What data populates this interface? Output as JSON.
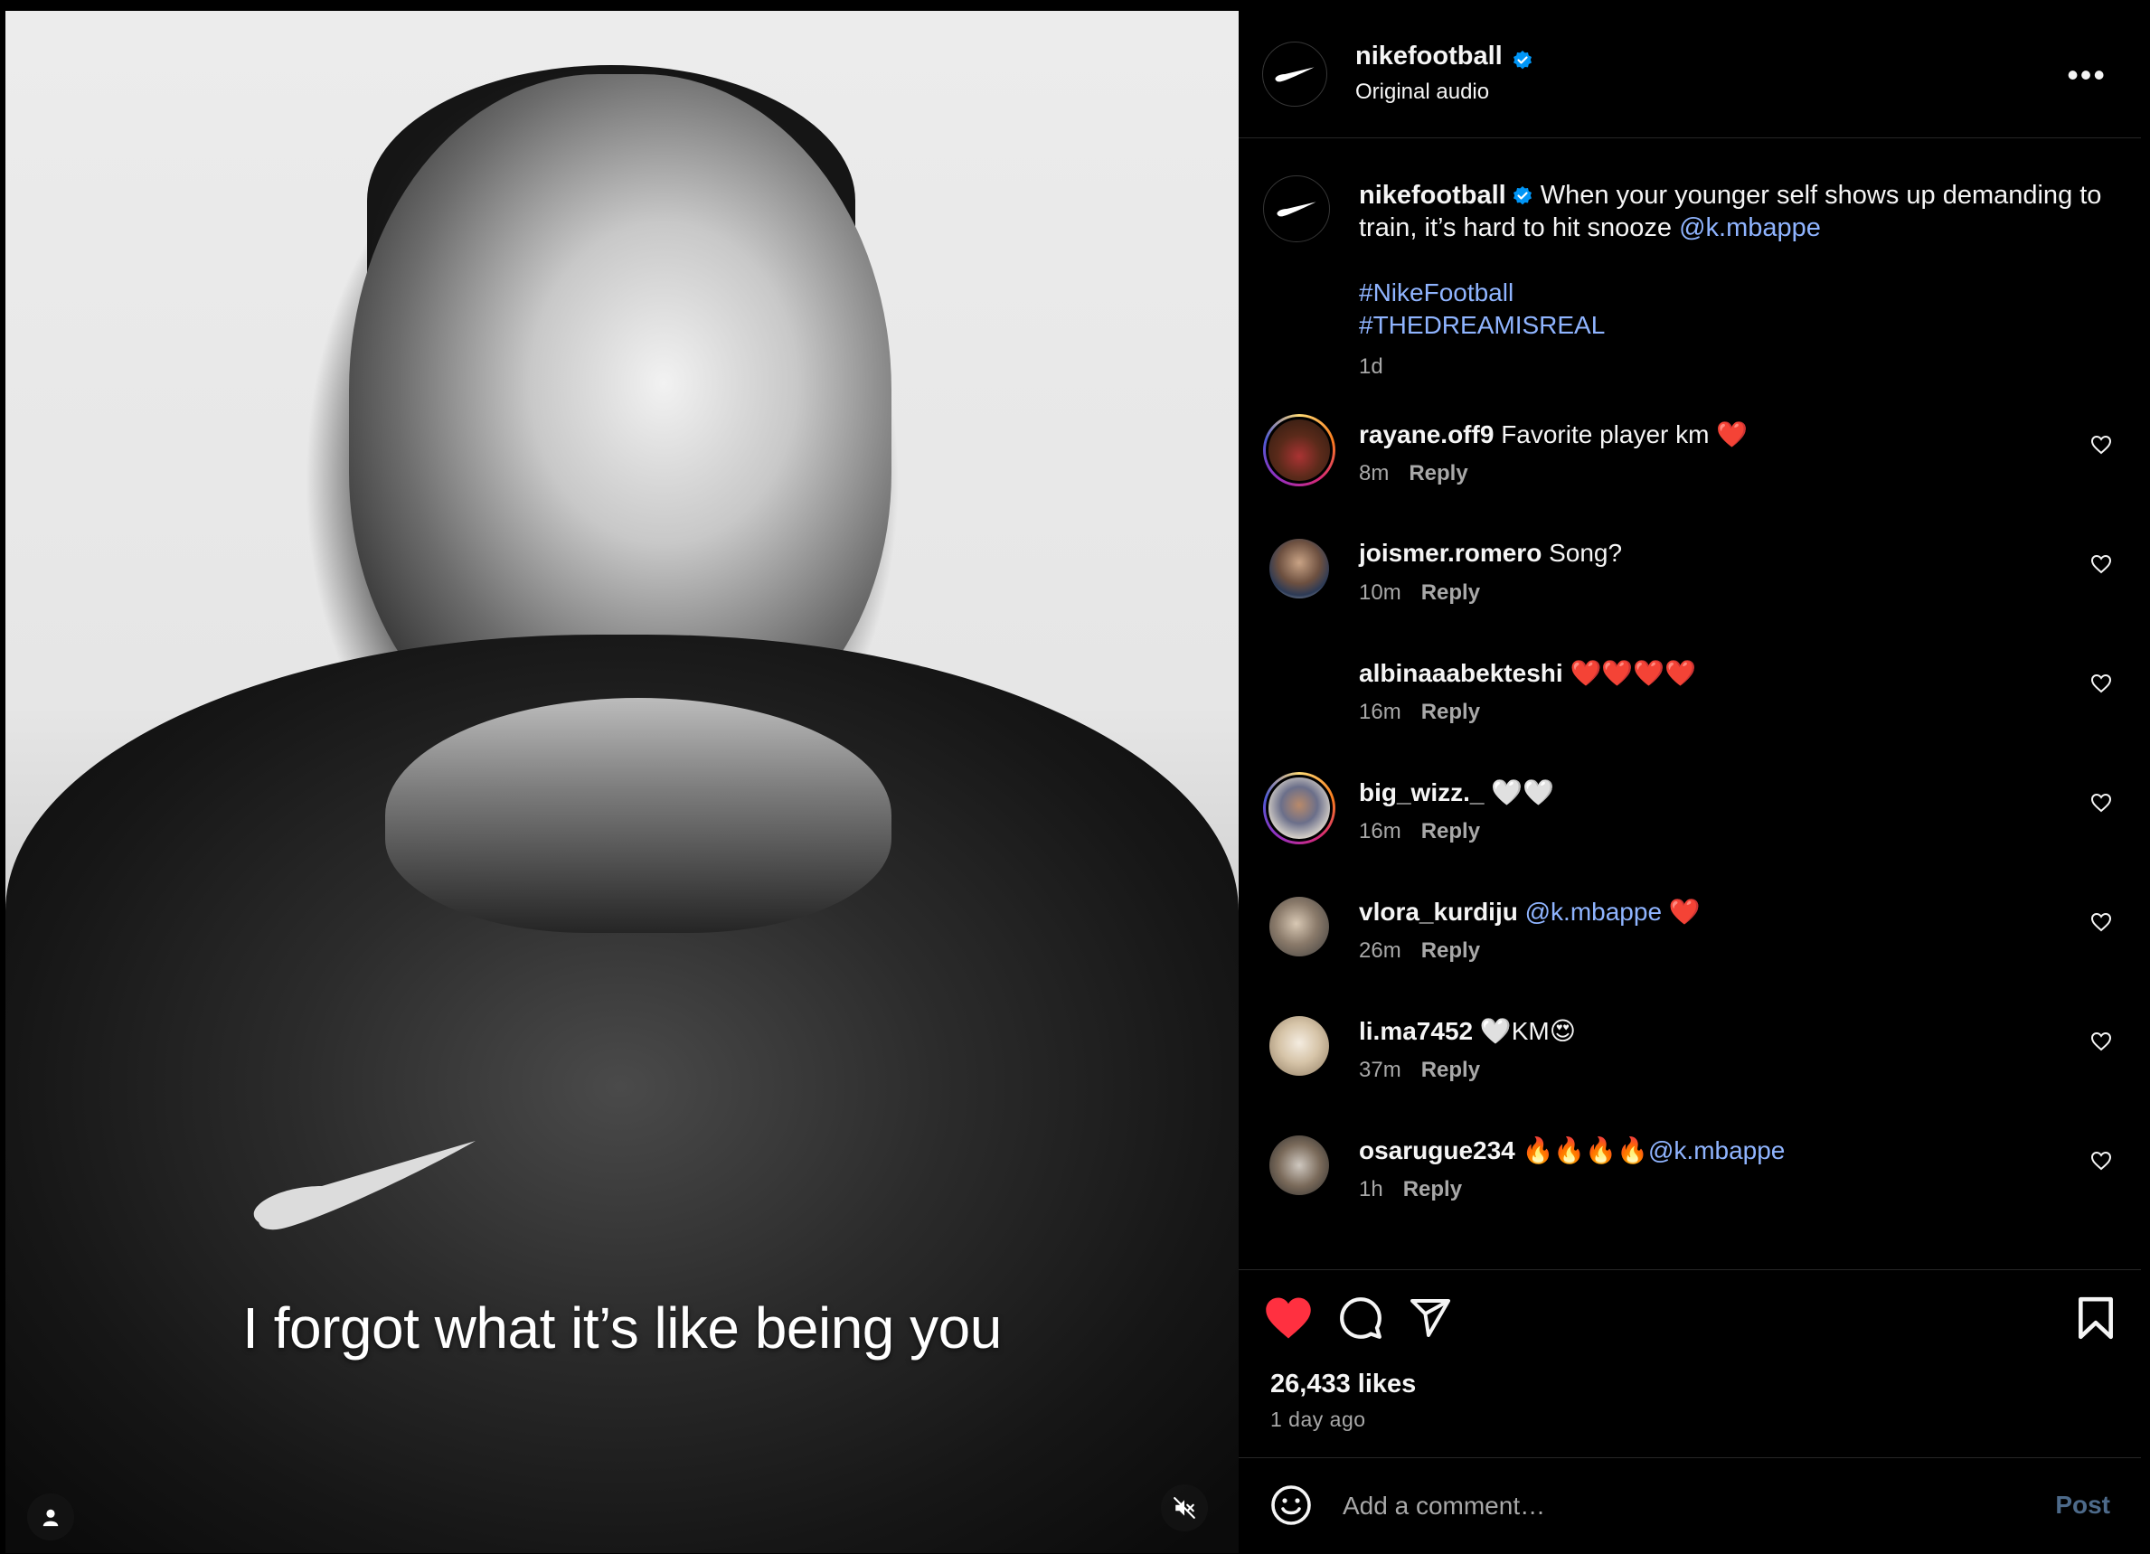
{
  "video": {
    "subtitle": "I forgot what it’s like being you",
    "profile_icon": "person-icon",
    "mute_icon": "volume-muted-icon"
  },
  "header": {
    "username": "nikefootball",
    "audio": "Original audio",
    "more_icon": "more-horizontal-icon",
    "more_label": "•••"
  },
  "post": {
    "username": "nikefootball",
    "text": "When your younger self shows up demanding to train, it’s hard to hit snooze",
    "mention": "@k.mbappe",
    "hashtags": [
      "#NikeFootball",
      "#THEDREAMISREAL"
    ],
    "time": "1d"
  },
  "comments": [
    {
      "user": "rayane.off9",
      "text": "Favorite player km ❤️",
      "time": "8m",
      "reply": "Reply"
    },
    {
      "user": "joismer.romero",
      "text": "Song?",
      "time": "10m",
      "reply": "Reply"
    },
    {
      "user": "albinaaabekteshi",
      "text": "❤️❤️❤️❤️",
      "time": "16m",
      "reply": "Reply"
    },
    {
      "user": "big_wizz._",
      "text": "🤍🤍",
      "time": "16m",
      "reply": "Reply"
    },
    {
      "user": "vlora_kurdiju",
      "text": "❤️",
      "mention": "@k.mbappe",
      "time": "26m",
      "reply": "Reply"
    },
    {
      "user": "li.ma7452",
      "text": "🤍KM😍",
      "time": "37m",
      "reply": "Reply"
    },
    {
      "user": "osarugue234",
      "text": "🔥🔥🔥🔥",
      "mention": "@k.mbappe",
      "time": "1h",
      "reply": "Reply"
    }
  ],
  "actions": {
    "likes": "26,433 likes",
    "posted": "1 day ago",
    "icons": [
      "heart-filled-icon",
      "comment-icon",
      "share-icon",
      "bookmark-icon"
    ],
    "like_color": "#ff3040"
  },
  "add_comment": {
    "placeholder": "Add a comment…",
    "post_label": "Post",
    "emoji_icon": "emoji-icon"
  },
  "colors": {
    "background": "#000000",
    "link": "#8fb4ff",
    "verified": "#0095f6",
    "muted_text": "#a8a8a8",
    "divider": "#262626"
  }
}
